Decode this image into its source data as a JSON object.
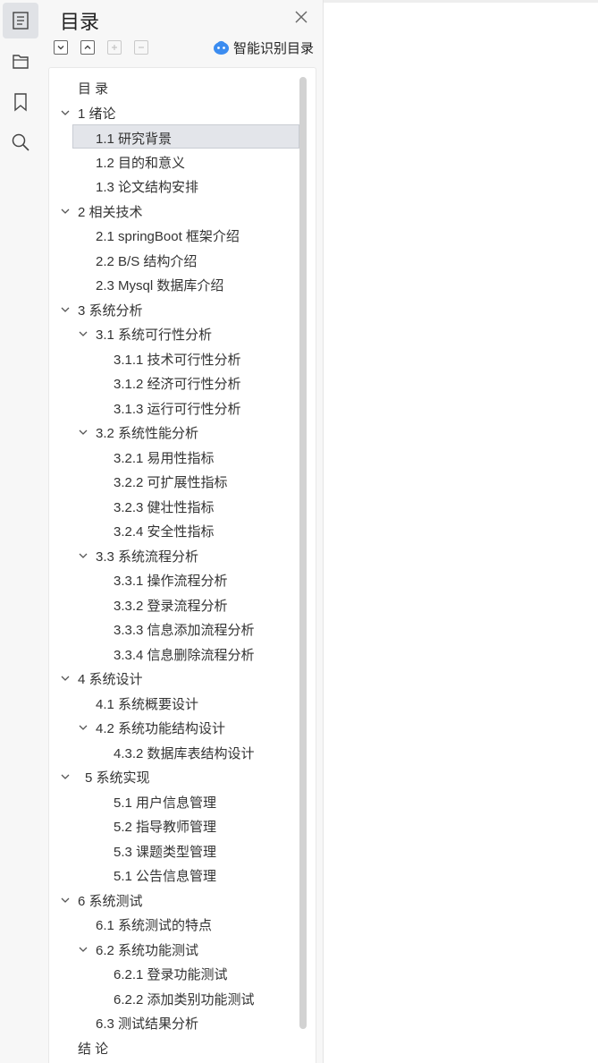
{
  "rail": {
    "items": [
      {
        "icon": "outline-icon",
        "active": true
      },
      {
        "icon": "folder-icon",
        "active": false
      },
      {
        "icon": "bookmark-icon",
        "active": false
      },
      {
        "icon": "search-icon",
        "active": false
      }
    ]
  },
  "panel": {
    "title": "目录",
    "smart_toc_label": "智能识别目录",
    "toolbar": [
      "collapse-all",
      "expand-all",
      "expand-level",
      "collapse-level"
    ]
  },
  "toc": [
    {
      "label": "目  录",
      "level": 0,
      "chevron": false
    },
    {
      "label": "1  绪论",
      "level": 0,
      "chevron": true
    },
    {
      "label": "1.1  研究背景",
      "level": 1,
      "chevron": false,
      "selected": true
    },
    {
      "label": "1.2  目的和意义",
      "level": 1,
      "chevron": false
    },
    {
      "label": "1.3  论文结构安排",
      "level": 1,
      "chevron": false
    },
    {
      "label": "2  相关技术",
      "level": 0,
      "chevron": true
    },
    {
      "label": "2.1 springBoot 框架介绍",
      "level": 1,
      "chevron": false
    },
    {
      "label": "2.2 B/S 结构介绍",
      "level": 1,
      "chevron": false
    },
    {
      "label": "2.3 Mysql 数据库介绍",
      "level": 1,
      "chevron": false
    },
    {
      "label": "3  系统分析",
      "level": 0,
      "chevron": true
    },
    {
      "label": "3.1  系统可行性分析",
      "level": 1,
      "chevron": true
    },
    {
      "label": "3.1.1  技术可行性分析",
      "level": 2,
      "chevron": false
    },
    {
      "label": "3.1.2  经济可行性分析",
      "level": 2,
      "chevron": false
    },
    {
      "label": "3.1.3  运行可行性分析",
      "level": 2,
      "chevron": false
    },
    {
      "label": "3.2  系统性能分析",
      "level": 1,
      "chevron": true
    },
    {
      "label": "3.2.1  易用性指标",
      "level": 2,
      "chevron": false
    },
    {
      "label": "3.2.2  可扩展性指标",
      "level": 2,
      "chevron": false
    },
    {
      "label": "3.2.3  健壮性指标",
      "level": 2,
      "chevron": false
    },
    {
      "label": "3.2.4  安全性指标",
      "level": 2,
      "chevron": false
    },
    {
      "label": "3.3  系统流程分析",
      "level": 1,
      "chevron": true
    },
    {
      "label": "3.3.1  操作流程分析",
      "level": 2,
      "chevron": false
    },
    {
      "label": "3.3.2  登录流程分析",
      "level": 2,
      "chevron": false
    },
    {
      "label": "3.3.3  信息添加流程分析",
      "level": 2,
      "chevron": false
    },
    {
      "label": "3.3.4  信息删除流程分析",
      "level": 2,
      "chevron": false
    },
    {
      "label": "4  系统设计",
      "level": 0,
      "chevron": true
    },
    {
      "label": "4.1  系统概要设计",
      "level": 1,
      "chevron": false
    },
    {
      "label": "4.2  系统功能结构设计",
      "level": 1,
      "chevron": true
    },
    {
      "label": "4.3.2  数据库表结构设计",
      "level": 2,
      "chevron": false
    },
    {
      "label": "5  系统实现",
      "level": 0,
      "chevron": true,
      "indent_extra": true
    },
    {
      "label": "5.1 用户信息管理",
      "level": 2,
      "chevron": false
    },
    {
      "label": "5.2  指导教师管理",
      "level": 2,
      "chevron": false
    },
    {
      "label": "5.3 课题类型管理",
      "level": 2,
      "chevron": false
    },
    {
      "label": "5.1 公告信息管理",
      "level": 2,
      "chevron": false
    },
    {
      "label": "6  系统测试",
      "level": 0,
      "chevron": true
    },
    {
      "label": "6.1  系统测试的特点",
      "level": 1,
      "chevron": false
    },
    {
      "label": "6.2  系统功能测试",
      "level": 1,
      "chevron": true
    },
    {
      "label": "6.2.1  登录功能测试",
      "level": 2,
      "chevron": false
    },
    {
      "label": "6.2.2  添加类别功能测试",
      "level": 2,
      "chevron": false
    },
    {
      "label": "6.3  测试结果分析",
      "level": 1,
      "chevron": false
    },
    {
      "label": "结  论",
      "level": 0,
      "chevron": false
    }
  ]
}
